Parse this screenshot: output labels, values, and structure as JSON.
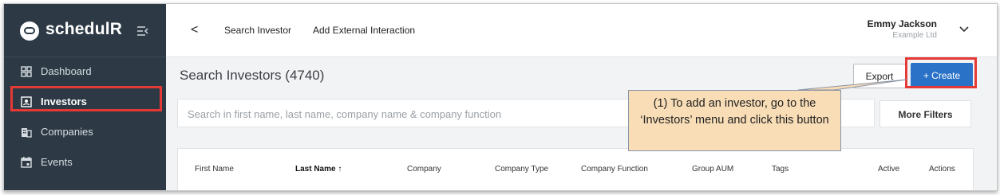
{
  "app": {
    "name": "schedulR"
  },
  "sidebar": {
    "items": [
      {
        "label": "Dashboard",
        "icon": "dashboard-grid-icon"
      },
      {
        "label": "Investors",
        "icon": "id-card-icon",
        "active": true
      },
      {
        "label": "Companies",
        "icon": "building-icon"
      },
      {
        "label": "Events",
        "icon": "calendar-icon"
      }
    ]
  },
  "topbar": {
    "back": "<",
    "tabs": [
      "Search Investor",
      "Add External Interaction"
    ],
    "user_name": "Emmy Jackson",
    "user_org": "Example Ltd"
  },
  "main": {
    "title": "Search Investors (4740)",
    "export_label": "Export",
    "create_label": "+ Create",
    "search_placeholder": "Search in first name, last name, company name & company function",
    "filters_label": "More Filters",
    "columns": [
      "First Name",
      "Last Name ↑",
      "Company",
      "Company Type",
      "Company Function",
      "Group AUM",
      "Tags",
      "Active",
      "Actions"
    ]
  },
  "annotation": {
    "text": "(1) To add an investor, go to the ‘Investors’ menu and click this button",
    "highlight_color": "#e53935",
    "callout_color": "#f8ddb6"
  },
  "colors": {
    "sidebar": "#2d3a45",
    "accent": "#2a72c8"
  }
}
